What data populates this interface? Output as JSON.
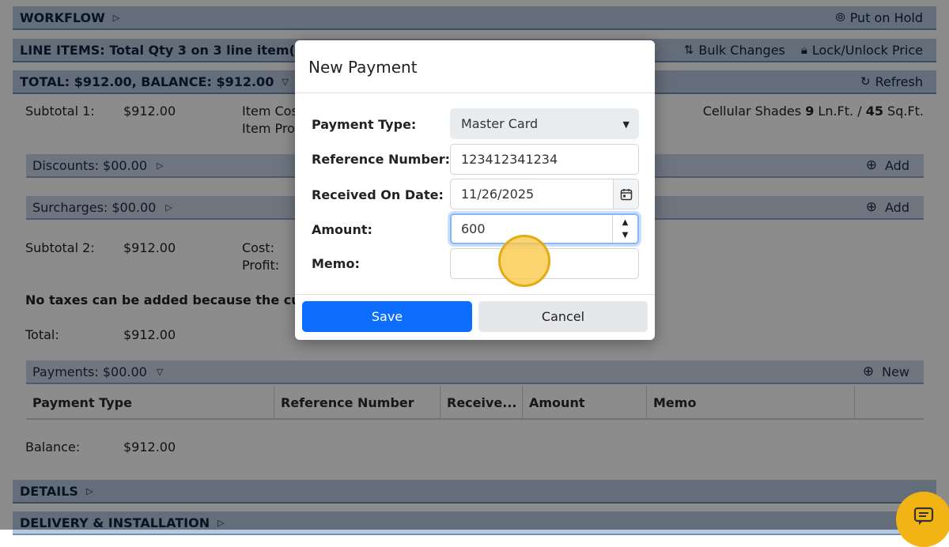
{
  "workflow": {
    "title": "WORKFLOW",
    "hold_label": "Put on Hold"
  },
  "line_items": {
    "title": "LINE ITEMS: Total Qty 3 on 3 line item(s): $9",
    "bulk_label": "Bulk Changes",
    "lock_label": "Lock/Unlock Price"
  },
  "totals": {
    "title": "TOTAL: $912.00, BALANCE: $912.00",
    "refresh_label": "Refresh",
    "subtotal1_label": "Subtotal 1:",
    "subtotal1_value": "$912.00",
    "item_cost_label": "Item Cos",
    "item_profit_label": "Item Pro",
    "shades_text_pre": "Cellular Shades ",
    "shades_lnft": "9",
    "shades_mid": " Ln.Ft. / ",
    "shades_sqft": "45",
    "shades_unit": " Sq.Ft.",
    "discounts_title": "Discounts: $00.00",
    "surcharges_title": "Surcharges: $00.00",
    "add_label": "Add",
    "subtotal2_label": "Subtotal 2:",
    "subtotal2_value": "$912.00",
    "cost_label": "Cost:",
    "profit_label": "Profit:",
    "tax_note": "No taxes can be added because the custo",
    "total_label": "Total:",
    "total_value": "$912.00",
    "payments_title": "Payments: $00.00",
    "new_label": "New",
    "payment_columns": [
      "Payment Type",
      "Reference Number",
      "Receive...",
      "Amount",
      "Memo"
    ],
    "balance_label": "Balance:",
    "balance_value": "$912.00"
  },
  "details": {
    "title": "DETAILS"
  },
  "delivery": {
    "title": "DELIVERY & INSTALLATION"
  },
  "modal": {
    "title": "New Payment",
    "payment_type_label": "Payment Type:",
    "payment_type_value": "Master Card",
    "reference_label": "Reference Number:",
    "reference_value": "123412341234",
    "date_label": "Received On Date:",
    "date_value": "11/26/2025",
    "amount_label": "Amount:",
    "amount_value": "600",
    "memo_label": "Memo:",
    "memo_value": "",
    "save_label": "Save",
    "cancel_label": "Cancel"
  }
}
